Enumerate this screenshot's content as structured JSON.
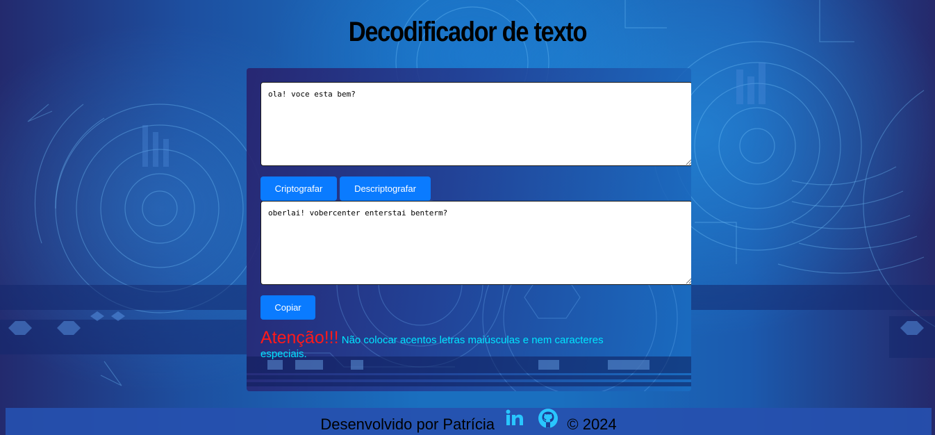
{
  "header": {
    "title": "Decodificador de texto"
  },
  "input": {
    "value": "ola! voce esta bem?"
  },
  "buttons": {
    "encrypt_label": "Criptografar",
    "decrypt_label": "Descriptografar",
    "copy_label": "Copiar"
  },
  "output": {
    "value": "oberlai! vobercenter enterstai benterm?"
  },
  "warning": {
    "title": "Atenção!!!",
    "message": "Não colocar acentos letras maiúsculas e nem caracteres especiais."
  },
  "footer": {
    "credit": "Desenvolvido por Patrícia",
    "copyright": "© 2024",
    "icons": [
      "linkedin-icon",
      "github-icon"
    ]
  },
  "colors": {
    "button": "#0a7bff",
    "warning_title": "#ff1a1a",
    "warning_text": "#00e5ff",
    "icon_accent": "#29c6ff"
  }
}
